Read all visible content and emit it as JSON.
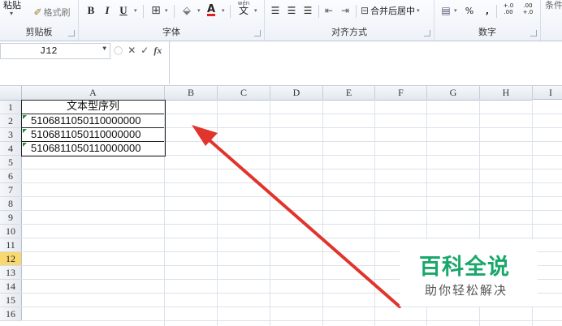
{
  "ribbon": {
    "paste_label": "粘贴",
    "format_painter_label": "格式刷",
    "clipboard_group": "剪贴板",
    "font_group": "字体",
    "bold": "B",
    "italic": "I",
    "underline": "U",
    "font_color_letter": "A",
    "phonetic": "wén",
    "phonetic_char": "文",
    "alignment_group": "对齐方式",
    "merge_center_label": "合并后居中",
    "number_group": "数字",
    "percent": "%",
    "comma": ",",
    "inc_decimal": "+.0 .00",
    "dec_decimal": ".00 +.0",
    "right_cut": "条件"
  },
  "formula_bar": {
    "name_box": "J12",
    "fx": "fx",
    "formula": ""
  },
  "sheet": {
    "columns": [
      "A",
      "B",
      "C",
      "D",
      "E",
      "F",
      "G",
      "H",
      "I"
    ],
    "rows": [
      "1",
      "2",
      "3",
      "4",
      "5",
      "6",
      "7",
      "8",
      "9",
      "10",
      "11",
      "12",
      "13",
      "14",
      "15",
      "16"
    ],
    "active_row": "12",
    "cells": {
      "A1": "文本型序列",
      "A2": "5106811050110000000",
      "A3": "5106811050110000000",
      "A4": "5106811050110000000"
    }
  },
  "watermark": {
    "title": "百科全说",
    "subtitle": "助你轻松解决"
  },
  "colors": {
    "arrow": "#e0342c",
    "active_row_header": "#f9d870",
    "watermark_green": "#1aa76a"
  }
}
